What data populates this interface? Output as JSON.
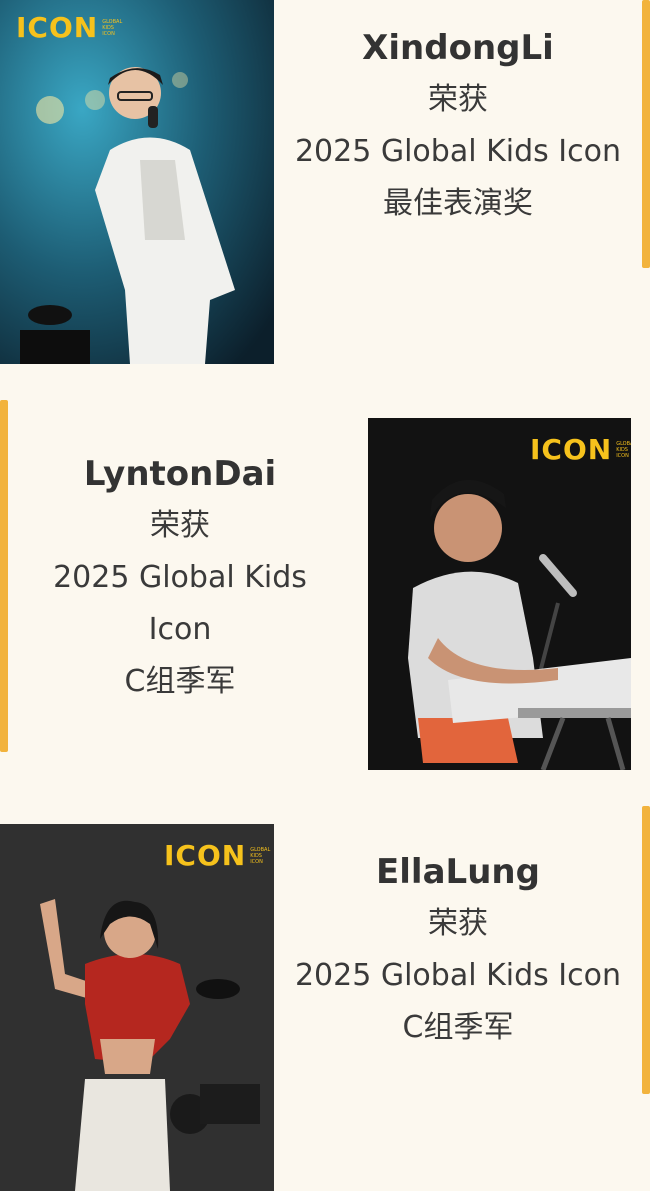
{
  "logo": {
    "word": "ICON",
    "tagline": "GLOBAL KIDS ICON"
  },
  "colors": {
    "accent": "#f2b33d",
    "logo": "#f6c21c",
    "background": "#fcf8ef"
  },
  "winners": [
    {
      "name": "XindongLi",
      "award_label": "荣获",
      "lines": [
        "2025 Global Kids Icon",
        "最佳表演奖"
      ]
    },
    {
      "name": "LyntonDai",
      "award_label": "荣获",
      "lines": [
        "2025 Global Kids",
        "Icon",
        "C组季军"
      ]
    },
    {
      "name": "EllaLung",
      "award_label": "荣获",
      "lines": [
        "2025 Global Kids Icon",
        "C组季军"
      ]
    }
  ]
}
